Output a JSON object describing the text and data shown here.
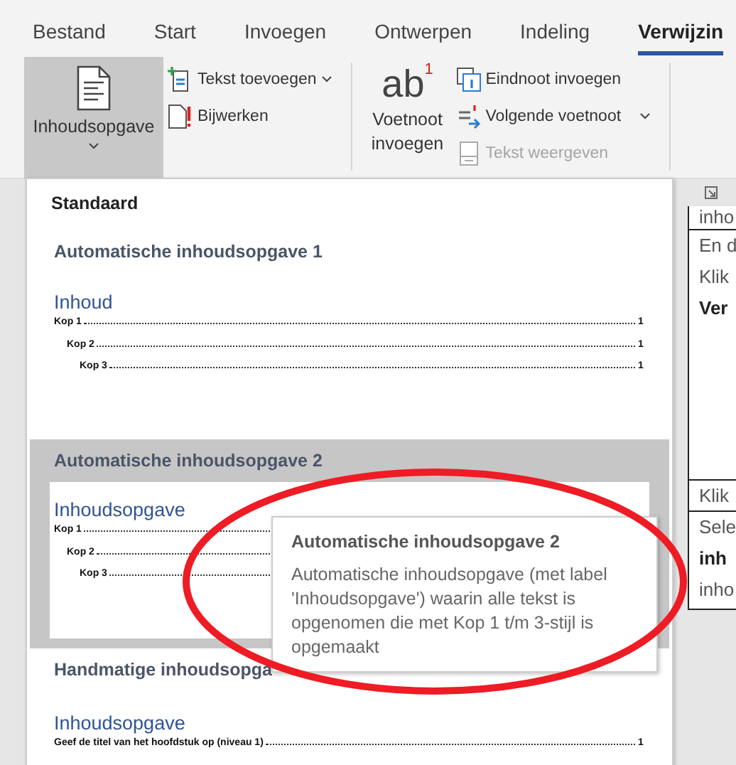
{
  "tabs": [
    {
      "label": "Bestand",
      "selected": false
    },
    {
      "label": "Start",
      "selected": false
    },
    {
      "label": "Invoegen",
      "selected": false
    },
    {
      "label": "Ontwerpen",
      "selected": false
    },
    {
      "label": "Indeling",
      "selected": false
    },
    {
      "label": "Verwijzin",
      "selected": true
    }
  ],
  "ribbon": {
    "toc_button": {
      "label": "Inhoudsopgave",
      "pressed": true
    },
    "toc_commands": [
      {
        "kind": "add-text",
        "label": "Tekst toevoegen",
        "dropdown": true,
        "disabled": false
      },
      {
        "kind": "update",
        "label": "Bijwerken",
        "dropdown": false,
        "disabled": false
      }
    ],
    "footnote_button": {
      "glyph": "ab",
      "mark": "1",
      "label": "Voetnoot invoegen"
    },
    "footnote_commands": [
      {
        "kind": "endnote",
        "label": "Eindnoot invoegen",
        "dropdown": false,
        "disabled": false
      },
      {
        "kind": "next-footnote",
        "label": "Volgende voetnoot",
        "dropdown": true,
        "disabled": false
      },
      {
        "kind": "show-notes",
        "label": "Tekst weergeven",
        "dropdown": false,
        "disabled": true
      }
    ]
  },
  "gallery": {
    "header": "Standaard",
    "items": [
      {
        "title": "Automatische inhoudsopgave 1",
        "selected": false,
        "preview": {
          "heading": "Inhoud",
          "entries": [
            {
              "label": "Kop 1",
              "page": "1",
              "children": [
                {
                  "label": "Kop 2",
                  "page": "1",
                  "children": [
                    {
                      "label": "Kop 3",
                      "page": "1"
                    }
                  ]
                }
              ]
            }
          ]
        }
      },
      {
        "title": "Automatische inhoudsopgave 2",
        "selected": true,
        "preview": {
          "heading": "Inhoudsopgave",
          "entries": [
            {
              "label": "Kop 1",
              "children": [
                {
                  "label": "Kop 2",
                  "children": [
                    {
                      "label": "Kop 3"
                    }
                  ]
                }
              ]
            }
          ]
        }
      },
      {
        "title": "Handmatige inhoudsopga",
        "selected": false,
        "preview": {
          "heading": "Inhoudsopgave",
          "entries": [
            {
              "label": "Geef de titel van het hoofdstuk op (niveau 1)",
              "page": "1"
            }
          ]
        }
      }
    ]
  },
  "tooltip": {
    "title": "Automatische inhoudsopgave 2",
    "text": "Automatische inhoudsopgave (met label 'Inhoudsopgave') waarin alle tekst is opgenomen die met Kop 1 t/m 3-stijl is opgemaakt"
  },
  "document": {
    "cells": [
      {
        "lines": [
          {
            "text": "inho",
            "bold": false
          }
        ]
      },
      {
        "lines": [
          {
            "text": "En d",
            "bold": false
          },
          {
            "text": "Klik",
            "bold": false
          },
          {
            "text": "Ver",
            "bold": true
          }
        ]
      },
      {
        "lines": [
          {
            "text": "Klik",
            "bold": false
          }
        ]
      },
      {
        "lines": [
          {
            "text": "Sele",
            "bold": false
          },
          {
            "text": "inh",
            "bold": true
          },
          {
            "text": "inho",
            "bold": false
          }
        ]
      }
    ]
  }
}
